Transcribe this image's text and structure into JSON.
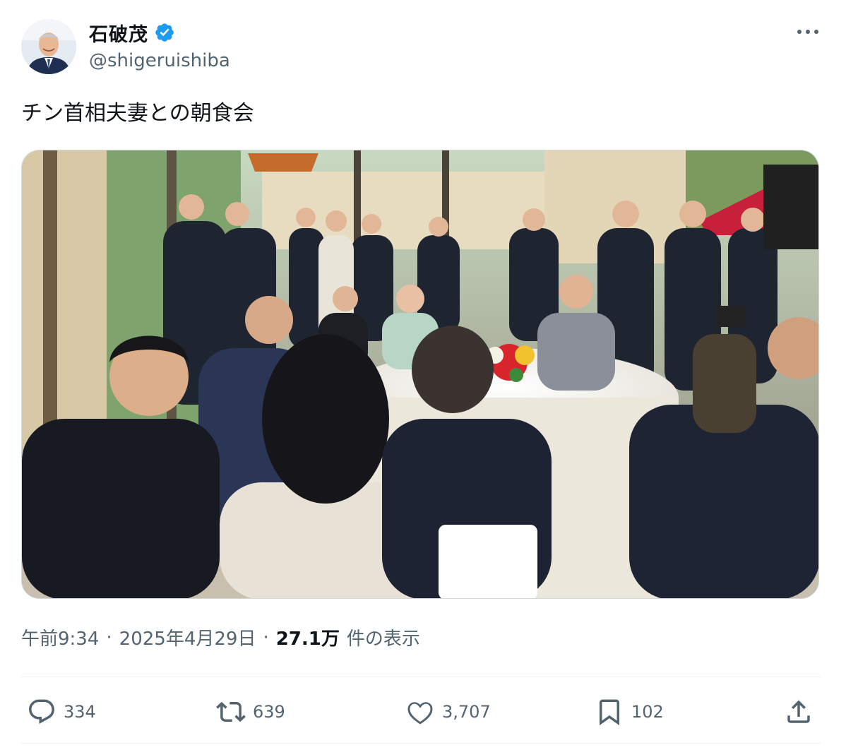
{
  "author": {
    "display_name": "石破茂",
    "handle": "@shigeruishiba"
  },
  "tweet": {
    "text": "チン首相夫妻との朝食会"
  },
  "meta": {
    "time": "午前9:34",
    "separator": "·",
    "date": "2025年4月29日",
    "views_count": "27.1万",
    "views_label": "件の表示"
  },
  "actions": {
    "replies": "334",
    "reposts": "639",
    "likes": "3,707",
    "bookmarks": "102"
  },
  "icons": {
    "verified": "verified-badge-icon",
    "more": "more-icon",
    "reply": "reply-icon",
    "repost": "repost-icon",
    "like": "like-icon",
    "bookmark": "bookmark-icon",
    "share": "share-icon"
  },
  "colors": {
    "verified_blue": "#1d9bf0",
    "secondary_text": "#536471",
    "primary_text": "#0f1419",
    "divider": "#eff3f4"
  }
}
